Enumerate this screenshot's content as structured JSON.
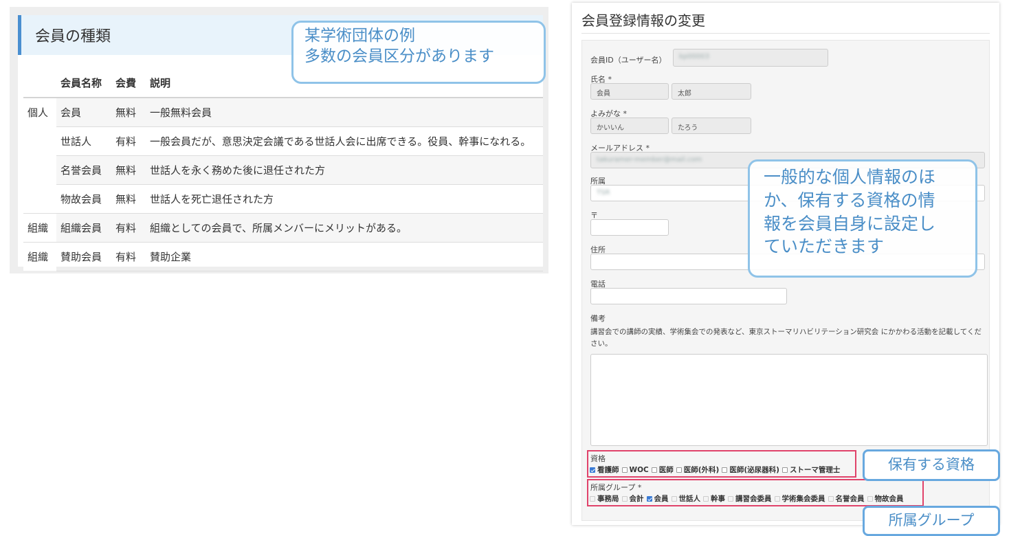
{
  "member_types": {
    "title": "会員の種類",
    "columns": {
      "name": "会員名称",
      "fee": "会費",
      "desc": "説明"
    },
    "rows": [
      {
        "category": "個人",
        "name": "会員",
        "fee": "無料",
        "desc": "一般無料会員"
      },
      {
        "category": "",
        "name": "世話人",
        "fee": "有料",
        "desc": "一般会員だが、意思決定会議である世話人会に出席できる。役員、幹事になれる。"
      },
      {
        "category": "",
        "name": "名誉会員",
        "fee": "無料",
        "desc": "世話人を永く務めた後に退任された方"
      },
      {
        "category": "",
        "name": "物故会員",
        "fee": "無料",
        "desc": "世話人を死亡退任された方"
      },
      {
        "category": "組織",
        "name": "組織会員",
        "fee": "有料",
        "desc": "組織としての会員で、所属メンバーにメリットがある。"
      },
      {
        "category": "組織",
        "name": "賛助会員",
        "fee": "有料",
        "desc": "賛助企業"
      }
    ]
  },
  "callouts": {
    "example_line1": "某学術団体の例",
    "example_line2": "多数の会員区分があります",
    "personal_info_lines": [
      "一般的な個人情報のほ",
      "か、保有する資格の情",
      "報を会員自身に設定し",
      "ていただきます"
    ],
    "qualification": "保有する資格",
    "group": "所属グループ"
  },
  "form": {
    "title": "会員登録情報の変更",
    "member_id_label": "会員ID（ユーザー名）",
    "member_id_value": "kp00003",
    "name_label": "氏名 *",
    "last_name": "会員",
    "first_name": "太郎",
    "kana_label": "よみがな *",
    "last_kana": "かいいん",
    "first_kana": "たろう",
    "email_label": "メールアドレス *",
    "email_value": "takuramer-member@mail.com",
    "affiliation_label": "所属",
    "affiliation_value": "TSR",
    "postal_label": "〒",
    "address_label": "住所",
    "phone_label": "電話",
    "note_label": "備考",
    "note_text": "講習会での講師の実績、学術集会での発表など、東京ストーマリハビリテーション研究会 にかかわる活動を記載してください。",
    "qualification_label": "資格",
    "qualifications": [
      {
        "label": "看護師",
        "checked": true
      },
      {
        "label": "WOC",
        "checked": false
      },
      {
        "label": "医師",
        "checked": false
      },
      {
        "label": "医師(外科)",
        "checked": false
      },
      {
        "label": "医師(泌尿器科)",
        "checked": false
      },
      {
        "label": "ストーマ管理士",
        "checked": false
      }
    ],
    "group_label": "所属グループ *",
    "groups": [
      {
        "label": "事務局",
        "checked": false
      },
      {
        "label": "会計",
        "checked": false
      },
      {
        "label": "会員",
        "checked": true
      },
      {
        "label": "世話人",
        "checked": false
      },
      {
        "label": "幹事",
        "checked": false
      },
      {
        "label": "講習会委員",
        "checked": false
      },
      {
        "label": "学術集会委員",
        "checked": false
      },
      {
        "label": "名誉会員",
        "checked": false
      },
      {
        "label": "物故会員",
        "checked": false
      }
    ]
  }
}
